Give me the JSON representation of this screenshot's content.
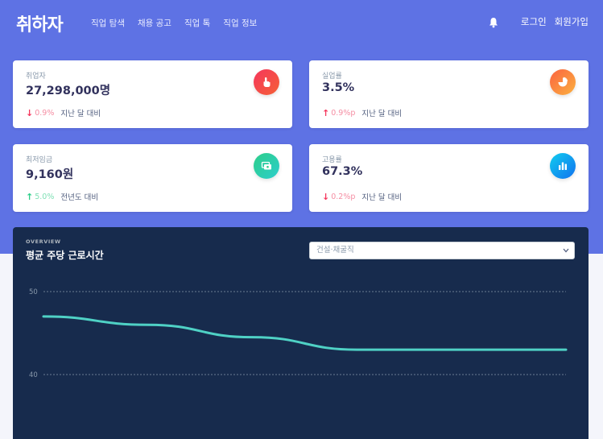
{
  "brand": {
    "logo": "취하자"
  },
  "nav": {
    "links": [
      "직업 탐색",
      "채용 공고",
      "직업 톡",
      "직업 정보"
    ],
    "login": "로그인",
    "signup": "회원가입",
    "bell_icon": "bell-icon"
  },
  "cards": [
    {
      "label": "취업자",
      "value": "27,298,000명",
      "change": "0.9%",
      "direction": "down",
      "since": "지난 달 대비",
      "icon": "hand-pointer-icon",
      "color": "#f5365c"
    },
    {
      "label": "실업률",
      "value": "3.5%",
      "change": "0.9%p",
      "direction": "up-bad",
      "since": "지난 달 대비",
      "icon": "chart-pie-icon",
      "color": "#fb6340"
    },
    {
      "label": "최저임금",
      "value": "9,160원",
      "change": "5.0%",
      "direction": "up",
      "since": "전년도 대비",
      "icon": "money-icon",
      "color": "#2dce89"
    },
    {
      "label": "고용률",
      "value": "67.3%",
      "change": "0.2%p",
      "direction": "down",
      "since": "지난 달 대비",
      "icon": "chart-bar-icon",
      "color": "#11cdef"
    }
  ],
  "panel": {
    "overline": "OVERVIEW",
    "title": "평균 주당 근로시간",
    "select_value": "건설·채굴직"
  },
  "chart_data": {
    "type": "line",
    "series": [
      {
        "values": [
          47,
          46,
          44.5,
          43,
          43,
          43
        ]
      }
    ],
    "x": [
      0,
      1,
      2,
      3,
      4,
      5
    ],
    "ylim": [
      40,
      50
    ],
    "yticks": [
      "50",
      "40"
    ],
    "grid": true,
    "line_color": "#4fd1c5"
  }
}
